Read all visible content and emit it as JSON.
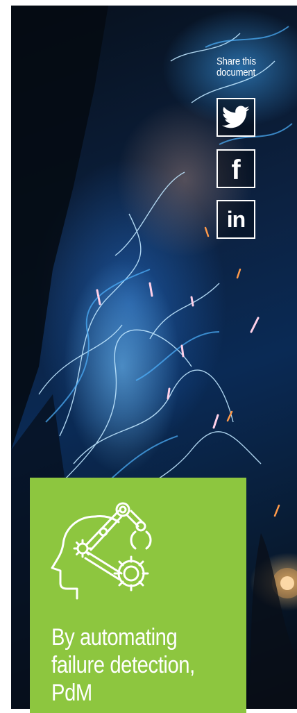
{
  "share": {
    "label": "Share this\ndocument",
    "buttons": [
      {
        "name": "twitter",
        "icon": "twitter-bird-icon"
      },
      {
        "name": "facebook",
        "icon": "facebook-f-icon",
        "glyph": "f"
      },
      {
        "name": "linkedin",
        "icon": "linkedin-in-icon",
        "glyph": "in"
      }
    ]
  },
  "card": {
    "icon": "ai-head-robot-arm-gears-icon",
    "text": "By automating failure detection, PdM",
    "background": "#8dc63f"
  },
  "hero": {
    "image": "welding-sparks-photo"
  }
}
